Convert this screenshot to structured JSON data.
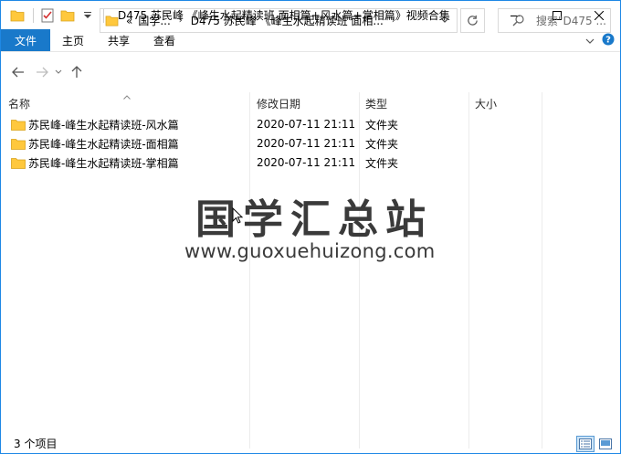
{
  "window": {
    "title": "D475 苏民峰 《峰生水起精读班 面相篇+风水篇+掌相篇》视频合集"
  },
  "ribbon": {
    "tabs": [
      {
        "label": "文件"
      },
      {
        "label": "主页"
      },
      {
        "label": "共享"
      },
      {
        "label": "查看"
      }
    ]
  },
  "address": {
    "overflow": "«",
    "crumbs": [
      "国学...",
      "D475 苏民峰 《峰生水起精读班 面相..."
    ]
  },
  "search": {
    "placeholder": "搜索\"D475 ..."
  },
  "columns": [
    {
      "label": "名称"
    },
    {
      "label": "修改日期"
    },
    {
      "label": "类型"
    },
    {
      "label": "大小"
    }
  ],
  "files": [
    {
      "name": "苏民峰-峰生水起精读班-风水篇",
      "modified": "2020-07-11 21:11",
      "type": "文件夹",
      "size": ""
    },
    {
      "name": "苏民峰-峰生水起精读班-面相篇",
      "modified": "2020-07-11 21:11",
      "type": "文件夹",
      "size": ""
    },
    {
      "name": "苏民峰-峰生水起精读班-掌相篇",
      "modified": "2020-07-11 21:11",
      "type": "文件夹",
      "size": ""
    }
  ],
  "watermark": {
    "title": "国学汇总站",
    "url": "www.guoxuehuizong.com"
  },
  "status": {
    "item_count": "3 个项目"
  },
  "colors": {
    "accent": "#1979ca",
    "folder": "#ffc83d",
    "border": "#1e88e5"
  }
}
